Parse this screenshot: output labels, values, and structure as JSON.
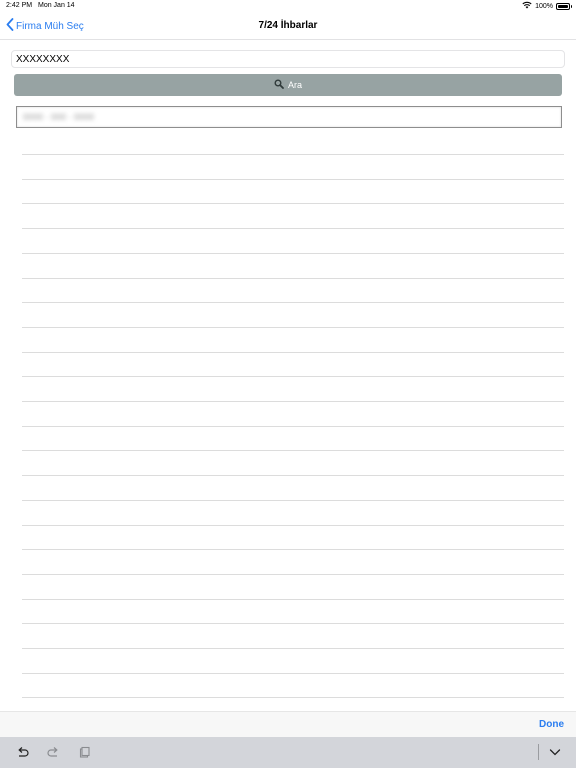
{
  "status_bar": {
    "time": "2:42 PM",
    "date": "Mon Jan 14",
    "battery": "100%"
  },
  "nav": {
    "back_label": "Firma Müh Seç",
    "title": "7/24 İhbarlar"
  },
  "search": {
    "value": "XXXXXXXX",
    "button_label": "Ara"
  },
  "result": {
    "blurred_text": "0000 · 000 · 0000"
  },
  "accessory": {
    "done_label": "Done"
  },
  "colors": {
    "accent": "#2a7df0",
    "search_button": "#97a3a3",
    "keyboard_bar": "#d3d5da"
  },
  "icons": [
    "chevron-left-icon",
    "wifi-icon",
    "battery-icon",
    "search-icon",
    "undo-icon",
    "redo-icon",
    "paste-icon",
    "chevron-down-icon"
  ]
}
